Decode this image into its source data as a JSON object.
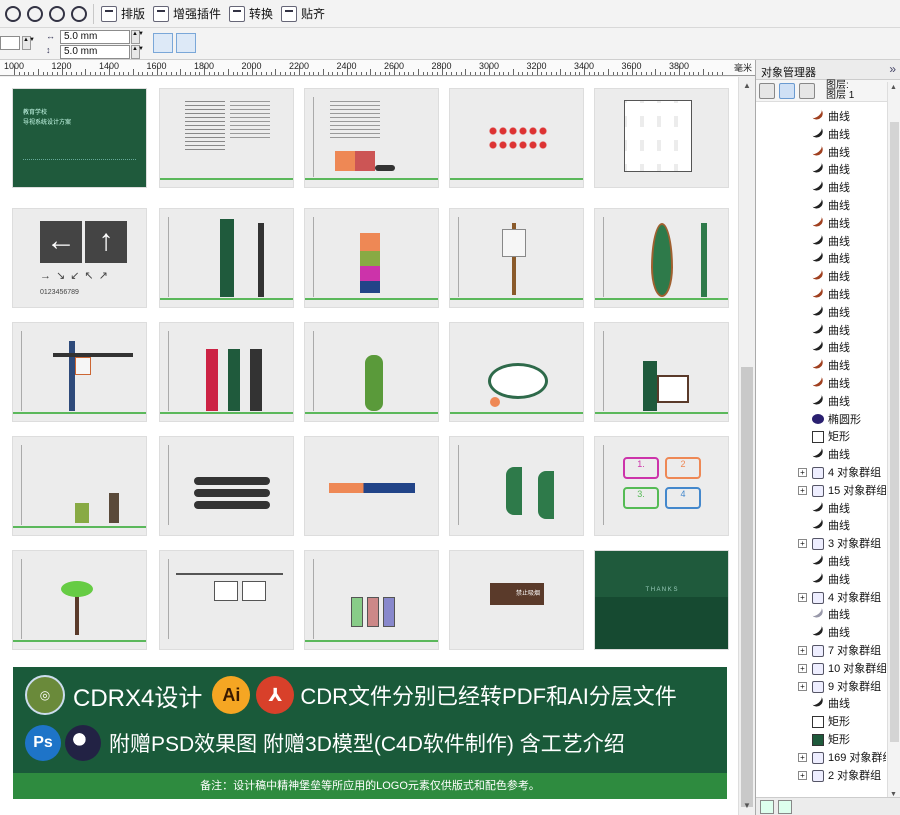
{
  "toolbar": {
    "items": [
      {
        "label": "排版",
        "icon": "layout-icon"
      },
      {
        "label": "增强插件",
        "icon": "plugin-icon"
      },
      {
        "label": "转换",
        "icon": "convert-icon"
      },
      {
        "label": "贴齐",
        "icon": "snap-icon"
      }
    ]
  },
  "propbar": {
    "nudge_x": "5.0 mm",
    "nudge_y": "5.0 mm"
  },
  "ruler": {
    "labels": [
      "1000",
      "1200",
      "1400",
      "1600",
      "1800",
      "2000",
      "2200",
      "2400",
      "2600",
      "2800",
      "3000",
      "3200",
      "3400",
      "3600",
      "3800"
    ],
    "unit": "毫米"
  },
  "thumbs": {
    "cover": {
      "line1": "教育学校",
      "line2": "导视系统设计方案"
    },
    "numbers": "0123456789",
    "bin_labels": [
      "1.",
      "2",
      "3.",
      "4"
    ],
    "sign_text": "禁止吸烟",
    "thanks": "T H A N K S"
  },
  "banner": {
    "line1": "CDRX4设计",
    "ai_logo": "Ai",
    "line1b": "CDR文件分别已经转PDF和AI分层文件",
    "ps_logo": "Ps",
    "line2": "附赠PSD效果图 附赠3D模型(C4D软件制作) 含工艺介绍",
    "note": "备注：设计稿中精神堡垒等所应用的LOGO元素仅供版式和配色参考。"
  },
  "panel": {
    "title": "对象管理器",
    "layers_label": "图层:",
    "layer_name": "图层 1",
    "items": [
      {
        "label": "曲线",
        "icon": "curve-brown-icon",
        "group": false
      },
      {
        "label": "曲线",
        "icon": "curve-dark-icon",
        "group": false
      },
      {
        "label": "曲线",
        "icon": "curve-brown-icon",
        "group": false
      },
      {
        "label": "曲线",
        "icon": "curve-dark-icon",
        "group": false
      },
      {
        "label": "曲线",
        "icon": "curve-dark-icon",
        "group": false
      },
      {
        "label": "曲线",
        "icon": "curve-dark-icon",
        "group": false
      },
      {
        "label": "曲线",
        "icon": "curve-brown-icon",
        "group": false
      },
      {
        "label": "曲线",
        "icon": "curve-dark-icon",
        "group": false
      },
      {
        "label": "曲线",
        "icon": "curve-dark-icon",
        "group": false
      },
      {
        "label": "曲线",
        "icon": "curve-brown-icon",
        "group": false
      },
      {
        "label": "曲线",
        "icon": "curve-brown-icon",
        "group": false
      },
      {
        "label": "曲线",
        "icon": "curve-dark-icon",
        "group": false
      },
      {
        "label": "曲线",
        "icon": "curve-dark-icon",
        "group": false
      },
      {
        "label": "曲线",
        "icon": "curve-dark-icon",
        "group": false
      },
      {
        "label": "曲线",
        "icon": "curve-brown-icon",
        "group": false
      },
      {
        "label": "曲线",
        "icon": "curve-brown-icon",
        "group": false
      },
      {
        "label": "曲线",
        "icon": "curve-dark-icon",
        "group": false
      },
      {
        "label": "椭圆形",
        "icon": "ellipse-icon",
        "group": false
      },
      {
        "label": "矩形",
        "icon": "rect-icon",
        "group": false
      },
      {
        "label": "曲线",
        "icon": "curve-dark-icon",
        "group": false
      },
      {
        "label": "4 对象群组",
        "icon": "group-icon",
        "group": true
      },
      {
        "label": "15 对象群组",
        "icon": "group-icon",
        "group": true
      },
      {
        "label": "曲线",
        "icon": "curve-dark-icon",
        "group": false
      },
      {
        "label": "曲线",
        "icon": "curve-dark-icon",
        "group": false
      },
      {
        "label": "3 对象群组",
        "icon": "group-icon",
        "group": true
      },
      {
        "label": "曲线",
        "icon": "curve-dark-icon",
        "group": false
      },
      {
        "label": "曲线",
        "icon": "curve-dark-icon",
        "group": false
      },
      {
        "label": "4 对象群组",
        "icon": "group-icon",
        "group": true
      },
      {
        "label": "曲线",
        "icon": "curve-light-icon",
        "group": false
      },
      {
        "label": "曲线",
        "icon": "curve-dark-icon",
        "group": false
      },
      {
        "label": "7 对象群组",
        "icon": "group-icon",
        "group": true
      },
      {
        "label": "10 对象群组",
        "icon": "group-icon",
        "group": true
      },
      {
        "label": "9 对象群组",
        "icon": "group-icon",
        "group": true
      },
      {
        "label": "曲线",
        "icon": "curve-dark-icon",
        "group": false
      },
      {
        "label": "矩形",
        "icon": "rect-icon",
        "group": false
      },
      {
        "label": "矩形",
        "icon": "rect-green-icon",
        "group": false
      },
      {
        "label": "169 对象群组",
        "icon": "group-icon",
        "group": true
      },
      {
        "label": "2 对象群组",
        "icon": "group-icon",
        "group": true
      }
    ]
  },
  "colors": {
    "brand_green": "#1a5a3a",
    "accent_green": "#2e8b3f",
    "curve_brown": "#8b3a1a"
  }
}
